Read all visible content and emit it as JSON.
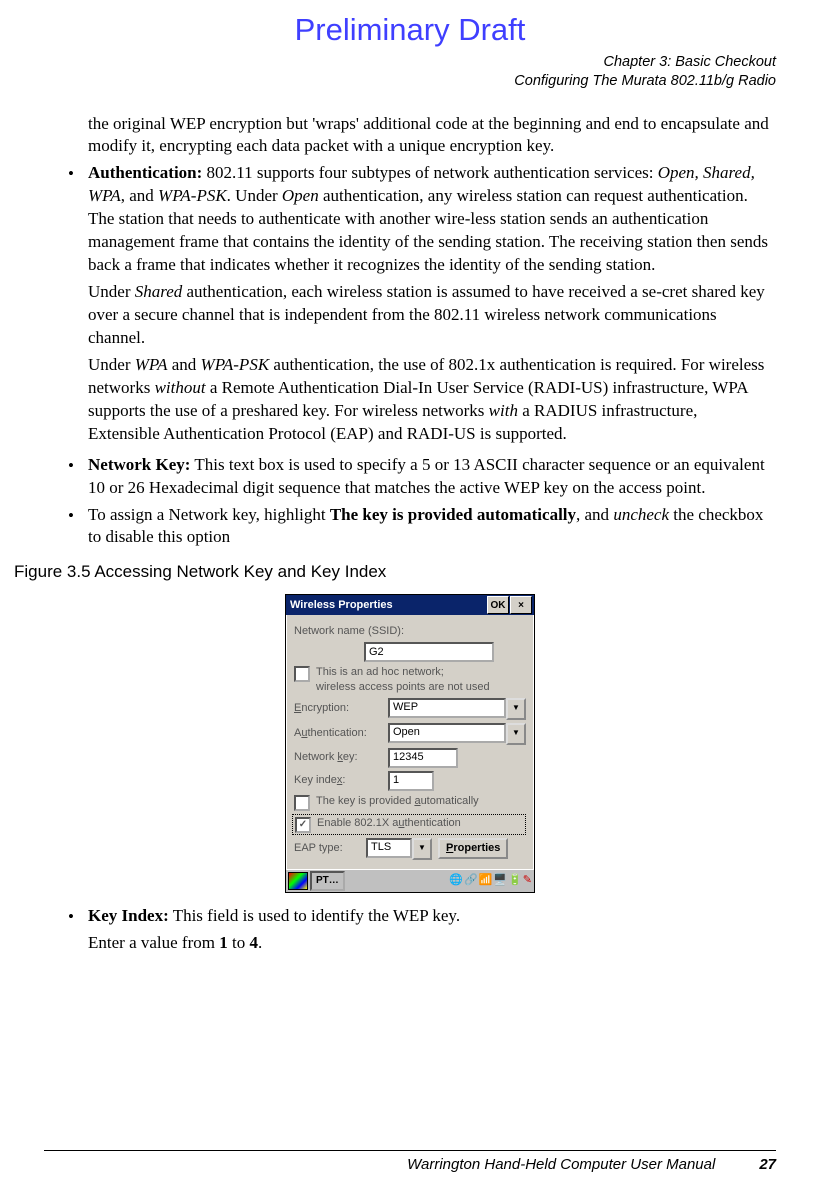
{
  "draft_label": "Preliminary Draft",
  "header": {
    "chapter": "Chapter 3:  Basic Checkout",
    "section": "Configuring The Murata 802.11b/g Radio"
  },
  "p_intro": "the original WEP encryption but 'wraps' additional code at the beginning and end to encapsulate and modify it, encrypting each data packet with a unique encryption key.",
  "auth": {
    "lead_bold": "Authentication:",
    "lead_rest1": " 802.11 supports four subtypes of network authentication services: ",
    "italic_list": "Open, Shared, WPA",
    "lead_between": ", and ",
    "italic_psk": "WPA-PSK",
    "lead_rest2": ". Under ",
    "italic_open": "Open",
    "lead_rest3": " authentication, any wireless station can request authentication. The station that needs to authenticate with another wire-less station sends an authentication management frame that contains the identity of the sending station. The receiving station then sends back a frame that indicates whether it recognizes the identity of the sending station.",
    "shared1": "Under ",
    "shared_it": "Shared",
    "shared2": " authentication, each wireless station is assumed to have received a se-cret shared key over a secure channel that is independent from the 802.11 wireless network communications channel.",
    "wpa1": "Under ",
    "wpa_it1": "WPA",
    "wpa_and": " and ",
    "wpa_it2": "WPA-PSK",
    "wpa2": " authentication, the use of 802.1x authentication is required. For wireless networks ",
    "wpa_without": "without",
    "wpa3": " a Remote Authentication Dial-In User Service (RADI-US) infrastructure, WPA supports the use of a preshared key. For wireless networks ",
    "wpa_with": "with",
    "wpa4": " a RADIUS infrastructure, Extensible Authentication Protocol (EAP) and RADI-US is supported."
  },
  "netkey": {
    "bold": "Network Key:",
    "rest": " This text box is used to specify a 5 or 13 ASCII character sequence or an equivalent 10 or 26 Hexadecimal digit sequence that matches the active WEP key on the access point."
  },
  "assign": {
    "p1": "To assign a Network key, highlight ",
    "bold": "The key is provided automatically",
    "p2": ", and ",
    "it": "uncheck",
    "p3": " the checkbox to disable this option"
  },
  "figcap": "Figure 3.5  Accessing Network Key and Key Index",
  "dialog": {
    "title": "Wireless Properties",
    "ok": "OK",
    "close": "×",
    "ssid_label": "Network name (SSID):",
    "ssid_value": "G2",
    "adhoc_line1": "This is an ad hoc network;",
    "adhoc_line2": "wireless access points are not used",
    "enc_label": "Encryption:",
    "enc_value": "WEP",
    "auth_label": "Authentication:",
    "auth_value": "Open",
    "key_label": "Network key:",
    "key_value": "12345",
    "idx_label": "Key index:",
    "idx_value": "1",
    "auto_label": "The key is provided automatically",
    "enable_label": "Enable 802.1X authentication",
    "eap_label": "EAP type:",
    "eap_value": "TLS",
    "props_btn": "Properties",
    "task_btn": "PT…"
  },
  "keyindex": {
    "bold": "Key Index:",
    "rest": " This field is used to identify the WEP key.",
    "line2a": "Enter a value from ",
    "b1": "1",
    "to": " to ",
    "b4": "4",
    "dot": "."
  },
  "footer": {
    "manual": "Warrington Hand-Held Computer User Manual",
    "page": "27"
  }
}
